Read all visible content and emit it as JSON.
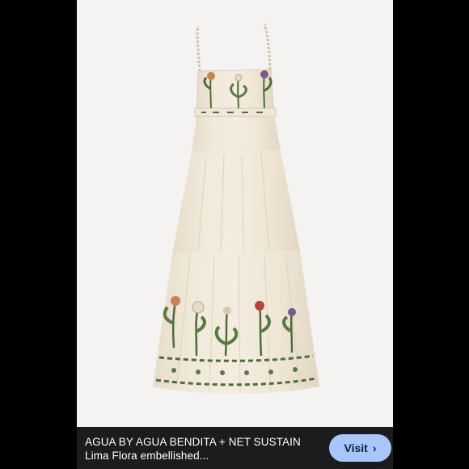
{
  "product": {
    "image_alt": "cream tiered maxi dress with floral embroidery",
    "caption": "AGUA BY AGUA BENDITA + NET SUSTAIN Lima Flora embellished..."
  },
  "actions": {
    "visit_label": "Visit",
    "visit_icon": "chevron-right-icon"
  },
  "colors": {
    "background": "#000000",
    "photo_bg": "#f4f3f1",
    "dress": "#efe6d7",
    "caption_bar": "#1c1c1e",
    "visit_button": "#a8c6fa"
  }
}
